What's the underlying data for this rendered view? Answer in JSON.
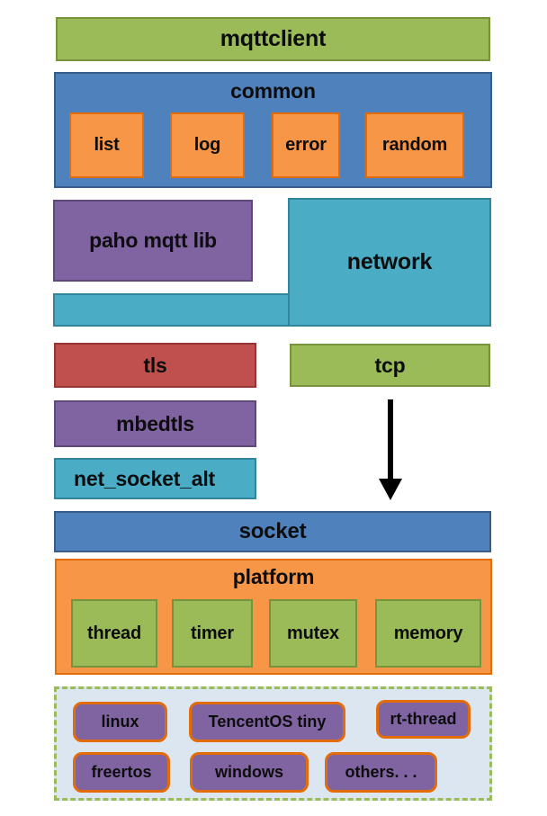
{
  "diagram": {
    "title": "mqtt client software architecture layers",
    "layers": {
      "app": {
        "label": "mqttclient",
        "color": "#9BBB59"
      },
      "common": {
        "label": "common",
        "color": "#4F81BD",
        "children": [
          {
            "label": "list",
            "color": "#F79646"
          },
          {
            "label": "log",
            "color": "#F79646"
          },
          {
            "label": "error",
            "color": "#F79646"
          },
          {
            "label": "random",
            "color": "#F79646"
          }
        ]
      },
      "mqtt_lib": {
        "label": "paho mqtt lib",
        "color": "#8064A2"
      },
      "network": {
        "label": "network",
        "color": "#4BACC6"
      },
      "network_bar": {
        "label": "",
        "color": "#4BACC6"
      },
      "tls": {
        "label": "tls",
        "color": "#C0504D"
      },
      "mbedtls": {
        "label": "mbedtls",
        "color": "#8064A2"
      },
      "net_socket_alt": {
        "label": "net_socket_alt",
        "color": "#4BACC6"
      },
      "tcp": {
        "label": "tcp",
        "color": "#9BBB59"
      },
      "socket": {
        "label": "socket",
        "color": "#4F81BD"
      },
      "platform": {
        "label": "platform",
        "color": "#F79646",
        "children": [
          {
            "label": "thread",
            "color": "#9BBB59"
          },
          {
            "label": "timer",
            "color": "#9BBB59"
          },
          {
            "label": "mutex",
            "color": "#9BBB59"
          },
          {
            "label": "memory",
            "color": "#9BBB59"
          }
        ]
      },
      "os": {
        "border_color": "#9BBB59",
        "background": "#DCE6F1",
        "items": [
          {
            "label": "linux"
          },
          {
            "label": "TencentOS tiny"
          },
          {
            "label": "rt-thread"
          },
          {
            "label": "freertos"
          },
          {
            "label": "windows"
          },
          {
            "label": "others. . ."
          }
        ]
      }
    },
    "connectors": [
      {
        "name": "tcp-to-socket",
        "type": "arrow-down",
        "color": "#000000"
      }
    ]
  }
}
